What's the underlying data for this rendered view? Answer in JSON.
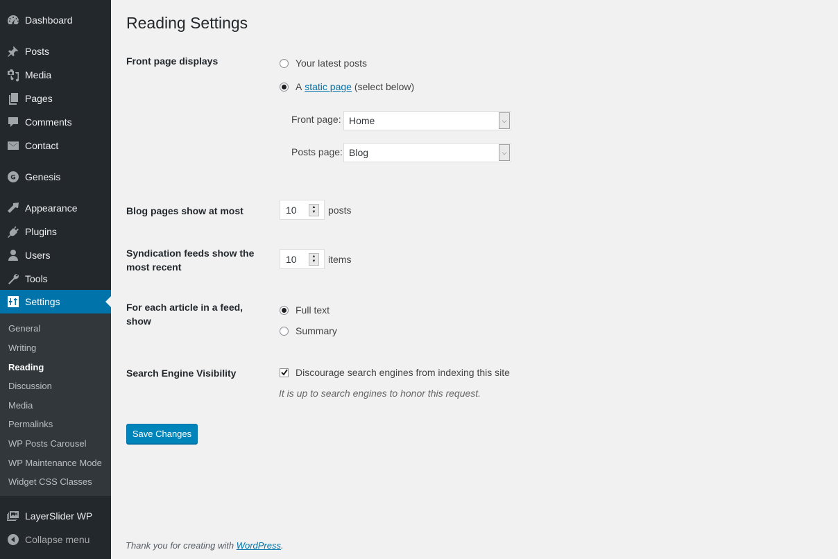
{
  "sidebar": {
    "items": [
      {
        "label": "Dashboard",
        "icon": "dashboard-icon"
      },
      {
        "label": "Posts",
        "icon": "pushpin-icon"
      },
      {
        "label": "Media",
        "icon": "media-icon"
      },
      {
        "label": "Pages",
        "icon": "pages-icon"
      },
      {
        "label": "Comments",
        "icon": "comment-icon"
      },
      {
        "label": "Contact",
        "icon": "envelope-icon"
      },
      {
        "label": "Genesis",
        "icon": "genesis-icon"
      },
      {
        "label": "Appearance",
        "icon": "paintbrush-icon"
      },
      {
        "label": "Plugins",
        "icon": "plugin-icon"
      },
      {
        "label": "Users",
        "icon": "user-icon"
      },
      {
        "label": "Tools",
        "icon": "wrench-icon"
      },
      {
        "label": "Settings",
        "icon": "settings-sliders-icon",
        "current": true
      }
    ],
    "submenu": [
      {
        "label": "General"
      },
      {
        "label": "Writing"
      },
      {
        "label": "Reading",
        "current": true
      },
      {
        "label": "Discussion"
      },
      {
        "label": "Media"
      },
      {
        "label": "Permalinks"
      },
      {
        "label": "WP Posts Carousel"
      },
      {
        "label": "WP Maintenance Mode"
      },
      {
        "label": "Widget CSS Classes"
      }
    ],
    "after_items": [
      {
        "label": "LayerSlider WP",
        "icon": "images-stack-icon"
      },
      {
        "label": "Collapse menu",
        "icon": "collapse-arrow-icon"
      }
    ]
  },
  "page": {
    "title": "Reading Settings",
    "front_page_displays": {
      "label": "Front page displays",
      "option_latest": "Your latest posts",
      "option_static_prefix": "A",
      "option_static_link": "static page",
      "option_static_suffix": "(select below)",
      "selected": "static",
      "front_page_label": "Front page:",
      "front_page_value": "Home",
      "posts_page_label": "Posts page:",
      "posts_page_value": "Blog"
    },
    "blog_pages": {
      "label": "Blog pages show at most",
      "value": "10",
      "suffix": "posts"
    },
    "syndication": {
      "label": "Syndication feeds show the most recent",
      "value": "10",
      "suffix": "items"
    },
    "feed_article": {
      "label": "For each article in a feed, show",
      "option_full": "Full text",
      "option_summary": "Summary",
      "selected": "full"
    },
    "search_visibility": {
      "label": "Search Engine Visibility",
      "checkbox_label": "Discourage search engines from indexing this site",
      "checked": true,
      "description": "It is up to search engines to honor this request."
    },
    "save_button": "Save Changes"
  },
  "footer": {
    "text": "Thank you for creating with",
    "link": "WordPress",
    "period": "."
  },
  "colors": {
    "sidebar_bg": "#23282d",
    "submenu_bg": "#32373c",
    "accent": "#0073aa",
    "button": "#0085ba",
    "page_bg": "#f1f1f1"
  }
}
